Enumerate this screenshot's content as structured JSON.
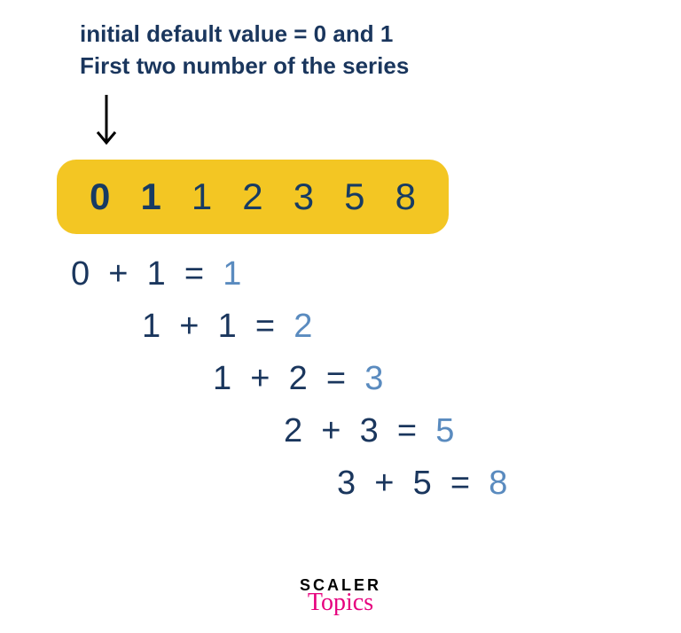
{
  "caption": {
    "line1": "initial default value = 0 and 1",
    "line2": "First two number of the series"
  },
  "series": [
    "0",
    "1",
    "1",
    "2",
    "3",
    "5",
    "8"
  ],
  "calculations": [
    {
      "a": "0",
      "op": "+",
      "b": "1",
      "eq": "=",
      "r": "1"
    },
    {
      "a": "1",
      "op": "+",
      "b": "1",
      "eq": "=",
      "r": "2"
    },
    {
      "a": "1",
      "op": "+",
      "b": "2",
      "eq": "=",
      "r": "3"
    },
    {
      "a": "2",
      "op": "+",
      "b": "3",
      "eq": "=",
      "r": "5"
    },
    {
      "a": "3",
      "op": "+",
      "b": "5",
      "eq": "=",
      "r": "8"
    }
  ],
  "logo": {
    "line1": "SCALER",
    "line2": "Topics"
  }
}
